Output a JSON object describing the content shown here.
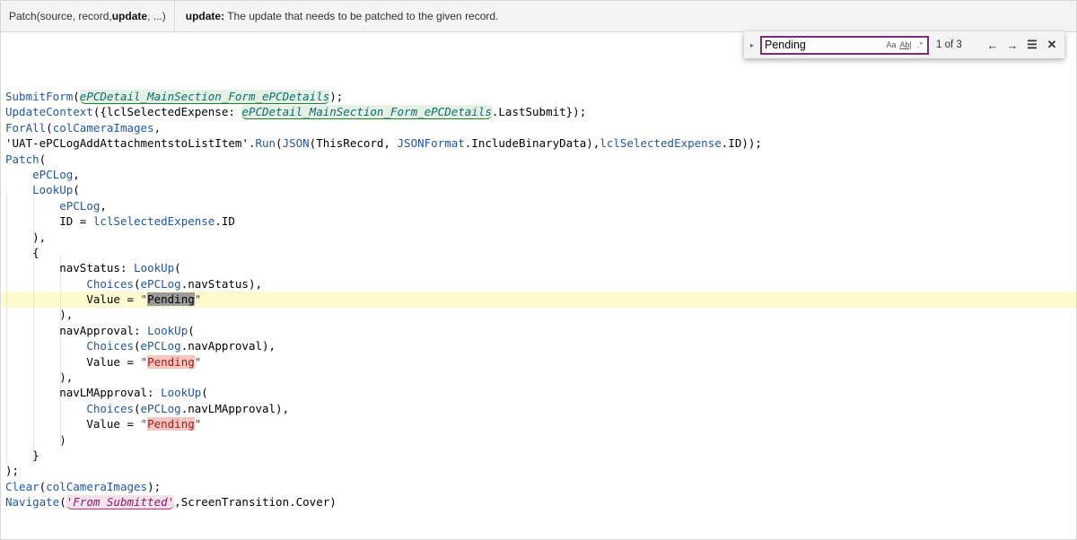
{
  "signature": {
    "call_prefix": "Patch(source, record, ",
    "active_param": "update",
    "call_suffix": ", ...)",
    "param_name": "update:",
    "param_description": " The update that needs to be patched to the given record."
  },
  "find": {
    "toggle_icon": "▸",
    "query": "Pending",
    "match_case_label": "Aa",
    "whole_word_label": "Ab|",
    "regex_label": ".*",
    "result_count": "1 of 3",
    "prev_icon": "←",
    "next_icon": "→",
    "selection_icon": "☰",
    "close_icon": "✕"
  },
  "colors": {
    "function": "#1f57a8",
    "string": "#9e1a1a",
    "control_ref": "#0a6f6f",
    "match_highlight": "#f6c7c0",
    "current_line": "#fffbd0",
    "find_border": "#7a2c7a"
  },
  "code": {
    "l1": {
      "fn": "SubmitForm",
      "p1": "(",
      "ctl": "ePCDetail_MainSection_Form_ePCDetails",
      "p2": ");"
    },
    "l2": {
      "fn": "UpdateContext",
      "p1": "({lclSelectedExpense: ",
      "ctl": "ePCDetail_MainSection_Form_ePCDetails",
      "p2": ".LastSubmit});"
    },
    "l3": {
      "fn": "ForAll",
      "p1": "(",
      "ref": "colCameraImages",
      "p2": ","
    },
    "l4": {
      "t1": "'UAT-ePCLogAddAttachmentstoListItem'.",
      "fn1": "Run",
      "t2": "(",
      "fn2": "JSON",
      "t3": "(ThisRecord, ",
      "ref1": "JSONFormat",
      "t4": ".IncludeBinaryData),",
      "ref2": "lclSelectedExpense",
      "t5": ".ID));"
    },
    "l5": {
      "fn": "Patch",
      "p": "("
    },
    "l6": {
      "indent": "    ",
      "ref": "ePCLog",
      "p": ","
    },
    "l7": {
      "indent": "    ",
      "fn": "LookUp",
      "p": "("
    },
    "l8": {
      "indent": "        ",
      "ref": "ePCLog",
      "p": ","
    },
    "l9": {
      "indent": "        ",
      "t1": "ID = ",
      "ref": "lclSelectedExpense",
      "t2": ".ID"
    },
    "l10": {
      "text": "    ),"
    },
    "l11": {
      "text": "    {"
    },
    "l12": {
      "indent": "        ",
      "t1": "navStatus: ",
      "fn": "LookUp",
      "p": "("
    },
    "l13": {
      "indent": "            ",
      "fn": "Choices",
      "p1": "(",
      "ref": "ePCLog",
      "p2": ".navStatus),"
    },
    "l14": {
      "indent": "            ",
      "t1": "Value = ",
      "q1": "\"",
      "m": "Pending",
      "q2": "\""
    },
    "l15": {
      "text": "        ),"
    },
    "l16": {
      "indent": "        ",
      "t1": "navApproval: ",
      "fn": "LookUp",
      "p": "("
    },
    "l17": {
      "indent": "            ",
      "fn": "Choices",
      "p1": "(",
      "ref": "ePCLog",
      "p2": ".navApproval),"
    },
    "l18": {
      "indent": "            ",
      "t1": "Value = ",
      "q1": "\"",
      "m": "Pending",
      "q2": "\""
    },
    "l19": {
      "text": "        ),"
    },
    "l20": {
      "indent": "        ",
      "t1": "navLMApproval: ",
      "fn": "LookUp",
      "p": "("
    },
    "l21": {
      "indent": "            ",
      "fn": "Choices",
      "p1": "(",
      "ref": "ePCLog",
      "p2": ".navLMApproval),"
    },
    "l22": {
      "indent": "            ",
      "t1": "Value = ",
      "q1": "\"",
      "m": "Pending",
      "q2": "\""
    },
    "l23": {
      "text": "        )"
    },
    "l24": {
      "text": "    }"
    },
    "l25": {
      "text": ");"
    },
    "l26": {
      "fn": "Clear",
      "p1": "(",
      "ref": "colCameraImages",
      "p2": ");"
    },
    "l27": {
      "fn": "Navigate",
      "p1": "(",
      "scr": "'From Submitted'",
      "p2": ",ScreenTransition.Cover)"
    }
  }
}
